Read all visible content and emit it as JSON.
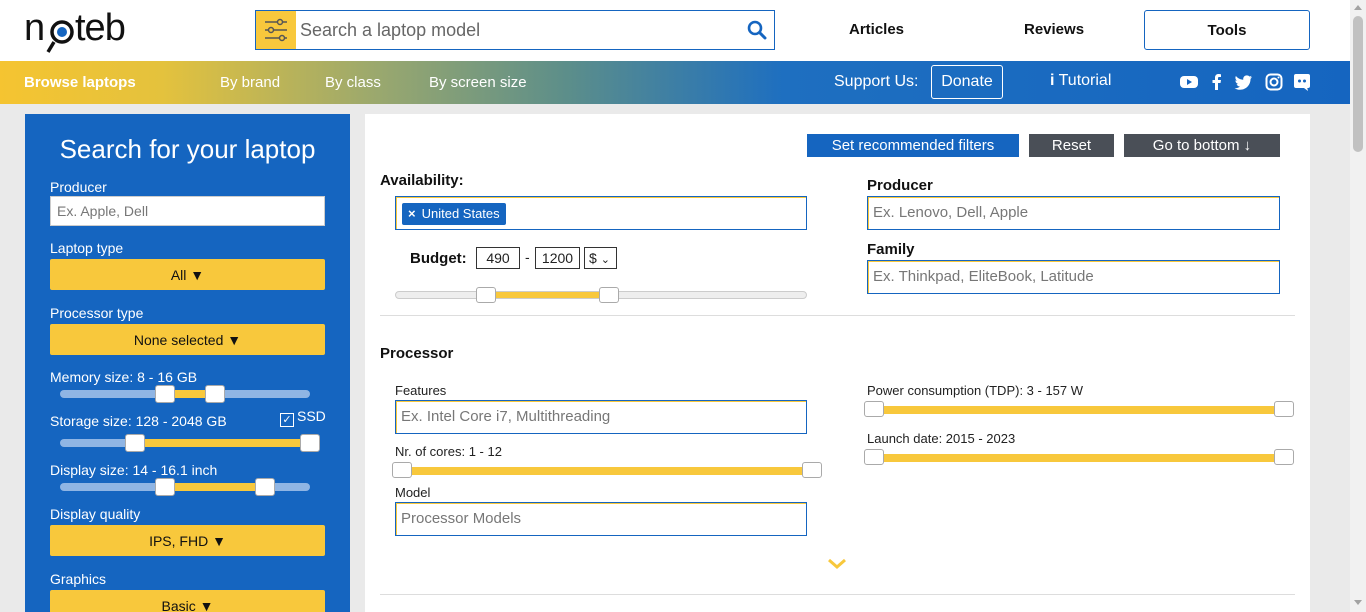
{
  "header": {
    "logo_text": "notebookcheck-style noteb logo",
    "search_placeholder": "Search a laptop model",
    "links": [
      "Articles",
      "Reviews"
    ],
    "tools_label": "Tools"
  },
  "nav": {
    "browse_label": "Browse laptops",
    "items": [
      "By brand",
      "By class",
      "By screen size"
    ],
    "support_label": "Support Us:",
    "donate_label": "Donate",
    "tutorial_label": "Tutorial",
    "social_icons": [
      "youtube-icon",
      "facebook-icon",
      "twitter-icon",
      "instagram-icon",
      "discord-icon"
    ]
  },
  "sidebar": {
    "title": "Search for your laptop",
    "producer_label": "Producer",
    "producer_placeholder": "Ex. Apple, Dell",
    "laptop_type_label": "Laptop type",
    "laptop_type_value": "All ▼",
    "processor_type_label": "Processor type",
    "processor_type_value": "None selected ▼",
    "memory_label": "Memory size: 8 - 16 GB",
    "memory_range": [
      0.42,
      0.62
    ],
    "storage_label": "Storage size: 128 - 2048 GB",
    "storage_range": [
      0.3,
      1.0
    ],
    "ssd_label": "SSD",
    "display_size_label": "Display size: 14 - 16.1 inch",
    "display_range": [
      0.42,
      0.82
    ],
    "display_quality_label": "Display quality",
    "display_quality_value": "IPS, FHD ▼",
    "graphics_label": "Graphics",
    "graphics_value": "Basic ▼"
  },
  "main": {
    "buttons": {
      "recommended": "Set recommended filters",
      "reset": "Reset",
      "bottom": "Go to bottom ↓"
    },
    "availability_label": "Availability:",
    "availability_chip": "United States",
    "budget_label": "Budget:",
    "budget_min": "490",
    "budget_max": "1200",
    "currency": "$",
    "budget_range": [
      0.22,
      0.52
    ],
    "producer_label": "Producer",
    "producer_placeholder": "Ex. Lenovo, Dell, Apple",
    "family_label": "Family",
    "family_placeholder": "Ex. Thinkpad, EliteBook, Latitude",
    "processor_heading": "Processor",
    "features_label": "Features",
    "features_placeholder": "Ex. Intel Core i7, Multithreading",
    "cores_label": "Nr. of cores: 1 - 12",
    "model_label": "Model",
    "model_placeholder": "Processor Models",
    "tdp_label": "Power consumption (TDP): 3 - 157 W",
    "launch_label": "Launch date: 2015 - 2023"
  },
  "colors": {
    "blue": "#1565c0",
    "yellow": "#f8c83c",
    "dark_button": "#4a4f57"
  }
}
